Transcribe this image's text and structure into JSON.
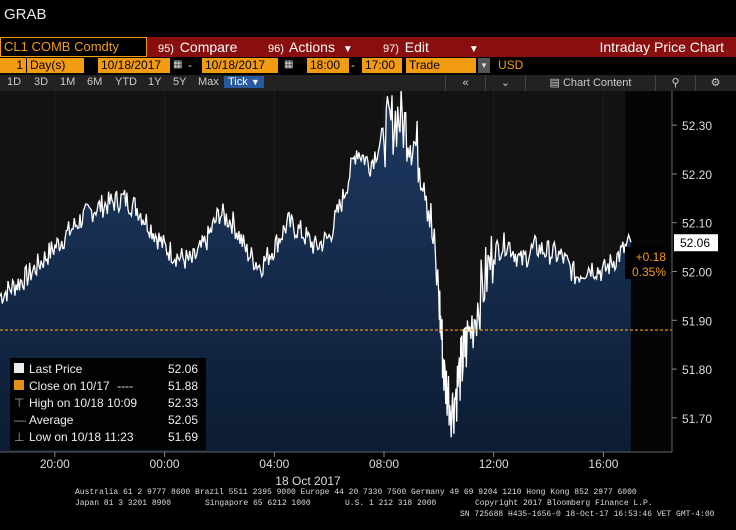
{
  "window": {
    "title": "GRAB"
  },
  "command_bar": {
    "ticker": "CL1 COMB Comdty",
    "compare": {
      "num": "95)",
      "label": "Compare"
    },
    "actions": {
      "num": "96)",
      "label": "Actions"
    },
    "edit": {
      "num": "97)",
      "label": "Edit"
    },
    "chart_title": "Intraday Price Chart"
  },
  "controls": {
    "period_count": "1",
    "period_unit": "Day(s)",
    "start_date": "10/18/2017",
    "end_date": "10/18/2017",
    "start_time": "18:00",
    "end_time": "17:00",
    "event": "Trade",
    "currency": "USD"
  },
  "nav": {
    "ranges": [
      "1D",
      "3D",
      "1M",
      "6M",
      "YTD",
      "1Y",
      "5Y",
      "Max"
    ],
    "tick_label": "Tick",
    "chart_content_label": "Chart Content",
    "collapse_glyph": "«"
  },
  "colors": {
    "line": "#ffffff",
    "fill_top": "#1e3a63",
    "fill_bottom": "#0c1c33",
    "accent": "#f39c12",
    "cmd_bg": "#8a0e0e"
  },
  "chart_data": {
    "type": "area",
    "x_axis_date": "18 Oct 2017",
    "x_ticks": [
      "20:00",
      "00:00",
      "04:00",
      "08:00",
      "12:00",
      "16:00"
    ],
    "y_ticks": [
      "52.30",
      "52.20",
      "52.10",
      "52.00",
      "51.90",
      "51.80",
      "51.70"
    ],
    "ylim": [
      51.63,
      52.37
    ],
    "series": [
      {
        "x": [
          18.0,
          18.5,
          19.0,
          19.5,
          20.0,
          20.5,
          21.0,
          21.5,
          22.0,
          22.5,
          23.0,
          23.5,
          24.0,
          24.5,
          25.0,
          25.5,
          26.0,
          26.5,
          27.0,
          27.5,
          28.0,
          28.5,
          29.0,
          29.5,
          30.0,
          30.5,
          31.0,
          31.5,
          32.0,
          32.5,
          33.0,
          33.5,
          34.0,
          34.2,
          34.5,
          34.8,
          35.0,
          35.5,
          36.0,
          36.5,
          37.0,
          37.5,
          38.0,
          38.5,
          39.0,
          39.5,
          40.0,
          40.5,
          41.0
        ],
        "values": [
          51.95,
          51.97,
          51.99,
          52.02,
          52.05,
          52.08,
          52.11,
          52.13,
          52.14,
          52.15,
          52.13,
          52.09,
          52.05,
          52.03,
          52.02,
          52.06,
          52.12,
          52.1,
          52.04,
          52.01,
          52.05,
          52.1,
          52.08,
          52.05,
          52.07,
          52.15,
          52.25,
          52.22,
          52.28,
          52.32,
          52.28,
          52.2,
          51.95,
          51.78,
          51.72,
          51.8,
          51.85,
          51.95,
          52.04,
          52.06,
          52.02,
          52.05,
          52.04,
          52.03,
          51.99,
          52.01,
          52.0,
          52.03,
          52.06
        ]
      }
    ],
    "last_change": "+0.18",
    "last_change_pct": "0.35%",
    "last_price_tag": "52.06",
    "prior_close_level": 51.88,
    "legend": [
      {
        "label": "Last Price",
        "value": "52.06"
      },
      {
        "label": "Close on 10/17",
        "dashes": "----",
        "value": "51.88"
      },
      {
        "label": "High on 10/18 10:09",
        "value": "52.33"
      },
      {
        "label": "Average",
        "value": "52.05"
      },
      {
        "label": "Low on 10/18 11:23",
        "value": "51.69"
      }
    ]
  },
  "footer": {
    "line1": "Australia 61 2 9777 8600 Brazil 5511 2395 9000 Europe 44 20 7330 7500 Germany 49 69 9204 1210 Hong Kong 852 2977 6000",
    "line2a": "Japan 81 3 3201 8900",
    "line2b": "Singapore 65 6212 1000",
    "line2c": "U.S. 1 212 318 2000",
    "line2d": "Copyright 2017 Bloomberg Finance L.P.",
    "line3": "SN 725688 H435-1656-0 18-Oct-17 16:53:46 VET  GMT-4:00"
  }
}
